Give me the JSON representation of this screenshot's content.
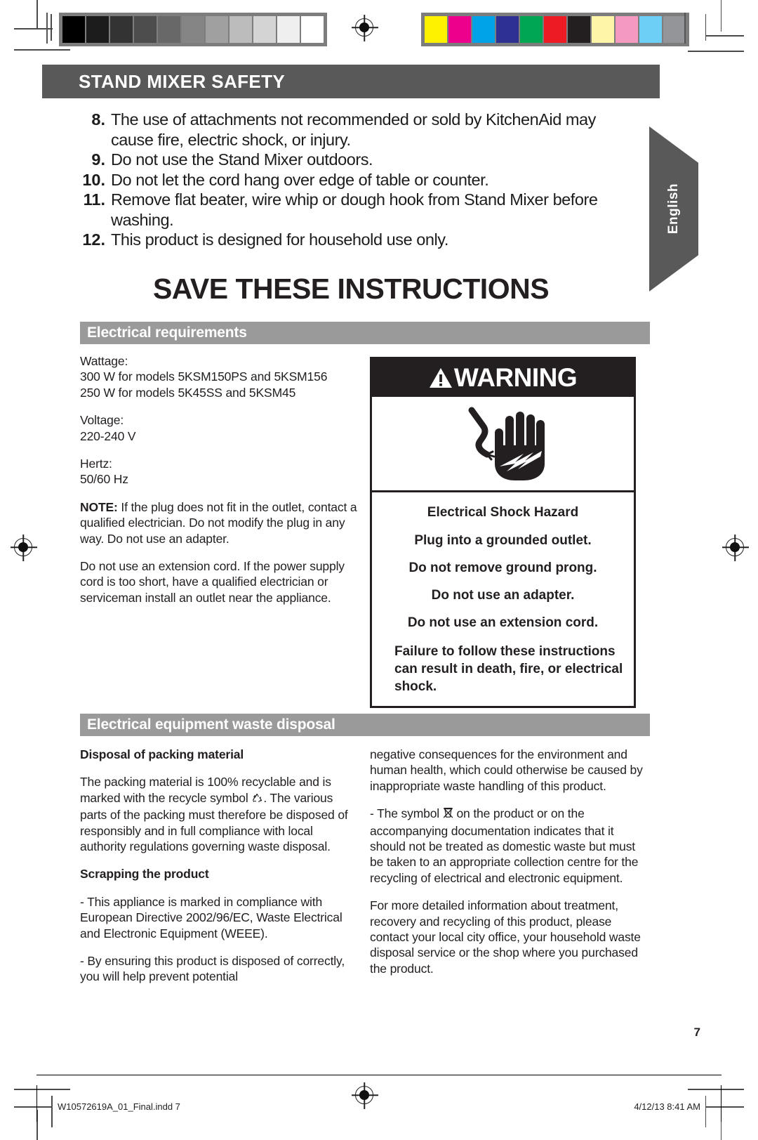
{
  "chapter": {
    "title": "STAND MIXER SAFETY"
  },
  "side_tab": {
    "label": "English"
  },
  "safety_list": [
    {
      "num": "8.",
      "text": "The use of attachments not recommended or sold by KitchenAid may cause fire, electric shock, or injury."
    },
    {
      "num": "9.",
      "text": "Do not use the Stand Mixer outdoors."
    },
    {
      "num": "10.",
      "text": "Do not let the cord hang over edge of table or counter."
    },
    {
      "num": "11.",
      "text": "Remove flat beater, wire whip or dough hook from Stand Mixer before washing."
    },
    {
      "num": "12.",
      "text": "This product is designed for household use only."
    }
  ],
  "save_instructions": "SAVE THESE INSTRUCTIONS",
  "electrical": {
    "section_title": "Electrical requirements",
    "wattage_label": "Wattage:",
    "wattage_line1": "300 W for models 5KSM150PS and 5KSM156",
    "wattage_line2": "250 W for models 5K45SS and 5KSM45",
    "voltage_label": "Voltage:",
    "voltage_value": "220-240 V",
    "hertz_label": "Hertz:",
    "hertz_value": "50/60 Hz",
    "note_label": "NOTE:",
    "note_text": " If the plug does not fit in the outlet, contact a qualified electrician. Do not modify the plug in any way. Do not use an adapter.",
    "extension_text": "Do not use an extension cord. If the power supply cord is too short, have a qualified electrician or serviceman install an outlet near the appliance."
  },
  "warning": {
    "title": "WARNING",
    "icon": "electric-shock-hand-icon",
    "hazard": "Electrical Shock Hazard",
    "items": [
      "Plug into a grounded outlet.",
      "Do not remove ground prong.",
      "Do not use an adapter.",
      "Do not use an extension cord."
    ],
    "failure_text": "Failure to follow these instructions can result in death, fire, or electrical shock."
  },
  "waste": {
    "section_title": "Electrical equipment waste disposal",
    "packing_head": "Disposal of packing material",
    "packing_p1_a": "The packing material is 100% recyclable and is marked with the recycle symbol ",
    "packing_p1_b": ". The various parts of the packing must therefore be disposed of responsibly and in full compliance with local authority regulations governing waste disposal.",
    "scrapping_head": "Scrapping the product",
    "scrap_p1": "- This appliance is marked in compliance with European Directive 2002/96/EC, Waste Electrical and Electronic Equipment (WEEE).",
    "scrap_p2": "- By ensuring this product is disposed of correctly, you will help prevent potential",
    "right_p1": "negative consequences for the environment and human health, which could otherwise be caused by inappropriate waste handling of this product.",
    "right_p2_a": "- The symbol ",
    "right_p2_b": " on the product or on the accompanying documentation indicates that it should not be treated as domestic waste but must be taken to an appropriate collection centre for the recycling of electrical and electronic equipment.",
    "right_p3": "For more detailed information about treatment, recovery and recycling of this product, please contact your local city office, your household waste disposal service or the shop where you purchased the product."
  },
  "page_number": "7",
  "footer": {
    "file": "W10572619A_01_Final.indd   7",
    "timestamp": "4/12/13   8:41 AM"
  },
  "calibration": {
    "grayscale": [
      "#000000",
      "#1c1c1c",
      "#333333",
      "#4d4d4d",
      "#686868",
      "#858585",
      "#a0a0a0",
      "#bcbcbc",
      "#d4d4d4",
      "#efefef",
      "#ffffff"
    ],
    "colors": [
      "#fff200",
      "#ec008c",
      "#00a2e8",
      "#2e3192",
      "#00a651",
      "#ed1c24",
      "#231f20",
      "#fff5a8",
      "#f49ac1",
      "#6dcff6",
      "#939598"
    ]
  }
}
